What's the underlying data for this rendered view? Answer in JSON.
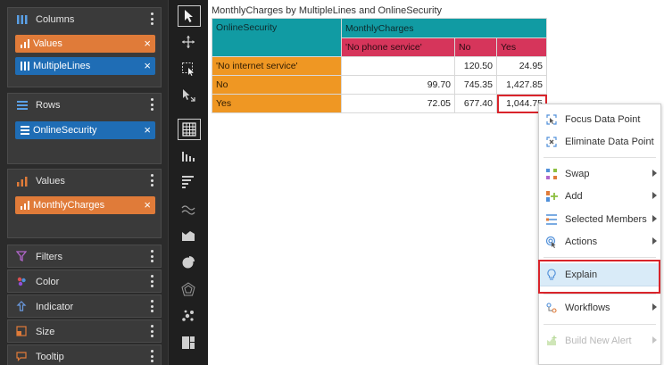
{
  "fields_panel": {
    "columns": {
      "title": "Columns",
      "items": [
        {
          "label": "Values",
          "kind": "orange"
        },
        {
          "label": "MultipleLines",
          "kind": "blue"
        }
      ]
    },
    "rows": {
      "title": "Rows",
      "items": [
        {
          "label": "OnlineSecurity",
          "kind": "blue"
        }
      ]
    },
    "values": {
      "title": "Values",
      "items": [
        {
          "label": "MonthlyCharges",
          "kind": "orange"
        }
      ]
    },
    "properties": [
      "Filters",
      "Color",
      "Indicator",
      "Size",
      "Tooltip"
    ],
    "remove_glyph": "×"
  },
  "toolbar": {
    "icons": [
      "pointer-icon",
      "move-icon",
      "select-region-icon",
      "drill-icon",
      "grid-table-icon",
      "column-chart-icon",
      "bar-chart-icon",
      "line-chart-icon",
      "area-chart-icon",
      "pie-chart-icon",
      "radar-chart-icon",
      "scatter-chart-icon",
      "treemap-icon"
    ],
    "selected_index": 4
  },
  "grid": {
    "title": "MonthlyCharges by MultipleLines and OnlineSecurity",
    "corner_label": "OnlineSecurity",
    "measure_label": "MonthlyCharges",
    "column_headers": [
      "'No phone service'",
      "No",
      "Yes"
    ],
    "rows": [
      {
        "label": "'No internet service'",
        "values": [
          "",
          "120.50",
          "24.95"
        ]
      },
      {
        "label": "No",
        "values": [
          "99.70",
          "745.35",
          "1,427.85"
        ]
      },
      {
        "label": "Yes",
        "values": [
          "72.05",
          "677.40",
          "1,044.75"
        ]
      }
    ],
    "highlighted_cell": "1,044.75"
  },
  "context_menu": {
    "focus": "Focus Data Point",
    "eliminate": "Eliminate Data Point",
    "swap": "Swap",
    "add": "Add",
    "selected_members": "Selected Members",
    "actions": "Actions",
    "explain": "Explain",
    "workflows": "Workflows",
    "build_alert": "Build New Alert"
  },
  "colors": {
    "teal_header": "#119ba3",
    "pink_header": "#d6355b",
    "orange_row": "#ef9723",
    "pill_orange": "#e07b39",
    "pill_blue": "#1f6db5",
    "highlight": "#d9242b",
    "menu_hover": "#d9ebf8"
  }
}
